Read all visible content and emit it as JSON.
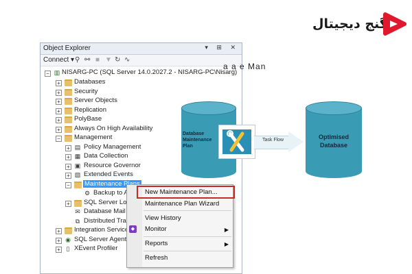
{
  "brand": {
    "name": "گنج دیجیتال",
    "colors": {
      "accent": "#e0182d"
    }
  },
  "object_explorer": {
    "title": "Object Explorer",
    "title_buttons": "▾ ⊞ ✕",
    "toolbar": {
      "connect_label": "Connect",
      "icons": [
        "connect-icon",
        "disconnect-icon",
        "stop-icon",
        "filter-icon",
        "refresh-icon",
        "activity-icon"
      ]
    },
    "tree": [
      {
        "label": "NISARG-PC (SQL Server 14.0.2027.2 - NISARG-PC\\Nisarg)",
        "icon": "server-icon",
        "expander": "−"
      },
      {
        "label": "Databases",
        "icon": "folder-icon",
        "expander": "+"
      },
      {
        "label": "Security",
        "icon": "folder-icon",
        "expander": "+"
      },
      {
        "label": "Server Objects",
        "icon": "folder-icon",
        "expander": "+"
      },
      {
        "label": "Replication",
        "icon": "folder-icon",
        "expander": "+"
      },
      {
        "label": "PolyBase",
        "icon": "folder-icon",
        "expander": "+"
      },
      {
        "label": "Always On High Availability",
        "icon": "folder-icon",
        "expander": "+"
      },
      {
        "label": "Management",
        "icon": "folder-icon",
        "expander": "−"
      },
      {
        "label": "Policy Management",
        "icon": "policy-icon",
        "expander": "+"
      },
      {
        "label": "Data Collection",
        "icon": "data-collection-icon",
        "expander": "+"
      },
      {
        "label": "Resource Governor",
        "icon": "resource-governor-icon",
        "expander": "+"
      },
      {
        "label": "Extended Events",
        "icon": "extended-events-icon",
        "expander": "+"
      },
      {
        "label": "Maintenance Plans",
        "icon": "folder-icon",
        "expander": "−",
        "selected": true
      },
      {
        "label": "Backup to A",
        "icon": "plan-icon",
        "expander": ""
      },
      {
        "label": "SQL Server Logs",
        "icon": "folder-icon",
        "expander": "+"
      },
      {
        "label": "Database Mail",
        "icon": "mail-icon",
        "expander": ""
      },
      {
        "label": "Distributed Tran",
        "icon": "dtc-icon",
        "expander": ""
      },
      {
        "label": "Integration Services",
        "icon": "folder-icon",
        "expander": "+"
      },
      {
        "label": "SQL Server Agent",
        "icon": "agent-icon",
        "expander": "+"
      },
      {
        "label": "XEvent Profiler",
        "icon": "profiler-icon",
        "expander": "+"
      }
    ]
  },
  "context_menu": {
    "items": [
      {
        "label": "New Maintenance Plan...",
        "highlighted": true
      },
      {
        "label": "Maintenance Plan Wizard"
      },
      {
        "label": "View History"
      },
      {
        "label": "Monitor",
        "submenu": true
      },
      {
        "label": "Reports",
        "submenu": true
      },
      {
        "label": "Refresh"
      }
    ]
  },
  "diagram": {
    "title": "a a e Man",
    "left_cylinder": "Database Maintenance Plan",
    "arrow_label": "Task Flow",
    "right_cylinder": "Optimised Database"
  }
}
